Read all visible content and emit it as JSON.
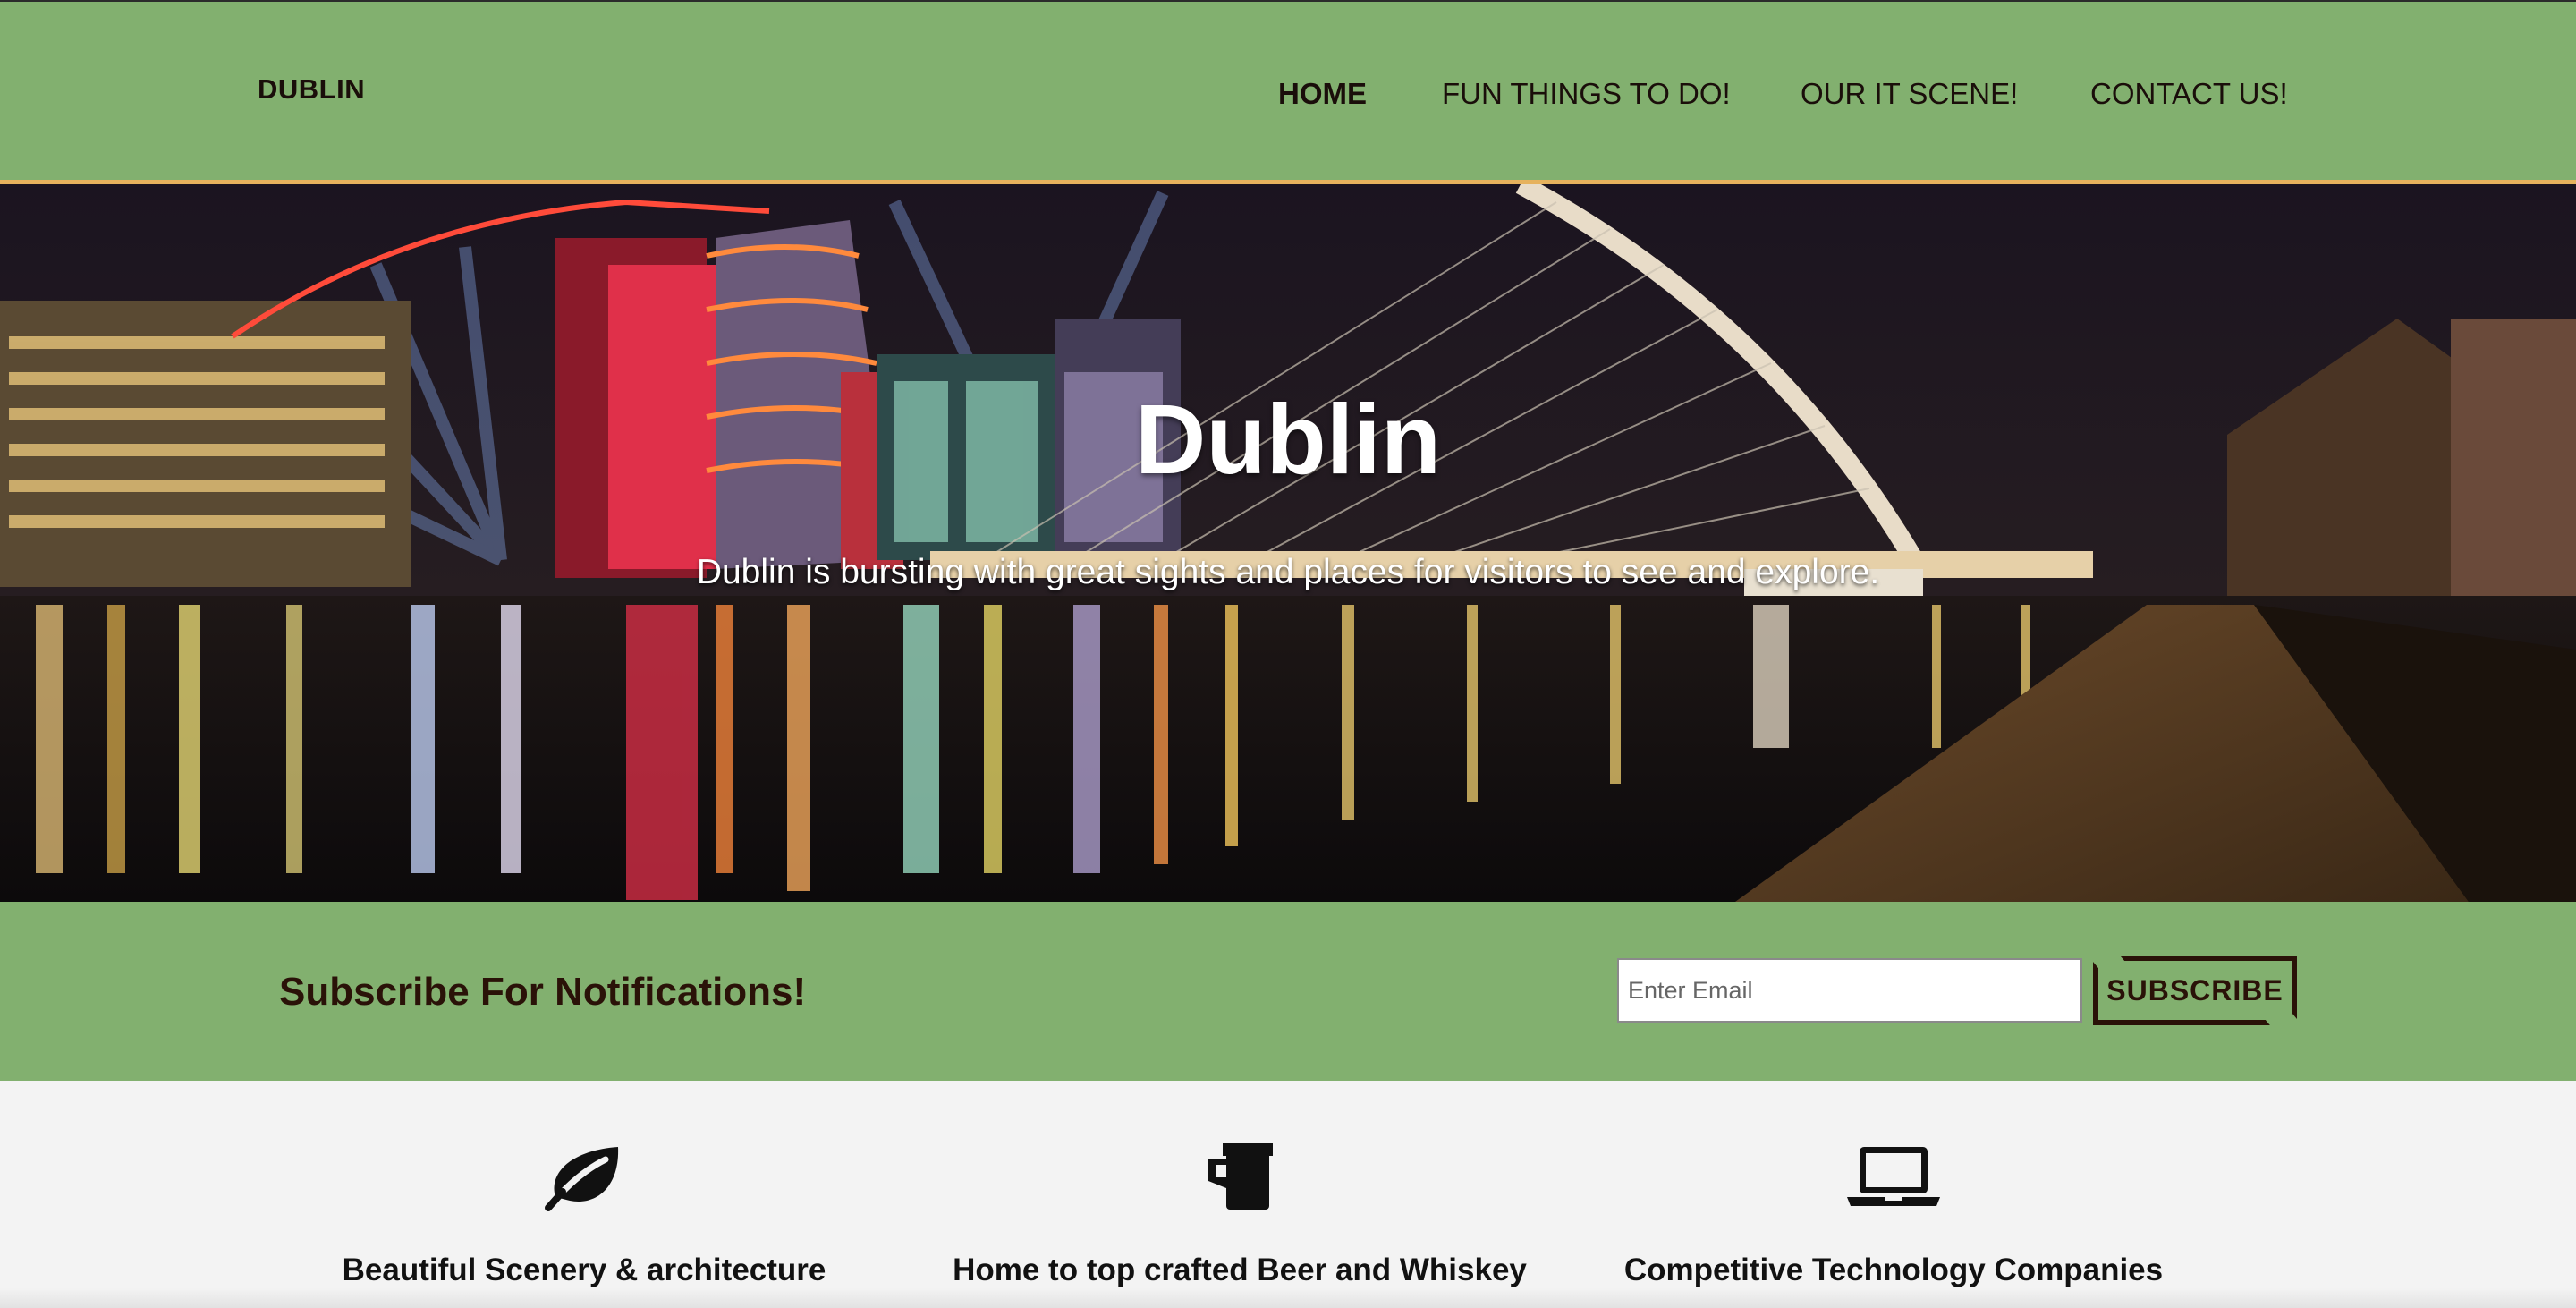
{
  "header": {
    "logo": "DUBLIN",
    "nav": [
      {
        "label": "HOME",
        "active": true
      },
      {
        "label": "FUN THINGS TO DO!",
        "active": false
      },
      {
        "label": "OUR IT SCENE!",
        "active": false
      },
      {
        "label": "CONTACT US!",
        "active": false
      }
    ]
  },
  "hero": {
    "title": "Dublin",
    "subtitle": "Dublin is bursting with great sights and places for visitors to see and explore."
  },
  "subscribe": {
    "title": "Subscribe For Notifications!",
    "email_placeholder": "Enter Email",
    "button_label": "SUBSCRIBE"
  },
  "features": [
    {
      "icon": "leaf-icon",
      "caption": "Beautiful Scenery & architecture"
    },
    {
      "icon": "beer-mug-icon",
      "caption": "Home to top crafted Beer and Whiskey"
    },
    {
      "icon": "laptop-icon",
      "caption": "Competitive Technology Companies"
    }
  ],
  "colors": {
    "header_bg": "#82b06f",
    "header_border": "#e6b25d",
    "text_dark": "#1a0e0a",
    "page_bg": "#f3f3f3"
  }
}
